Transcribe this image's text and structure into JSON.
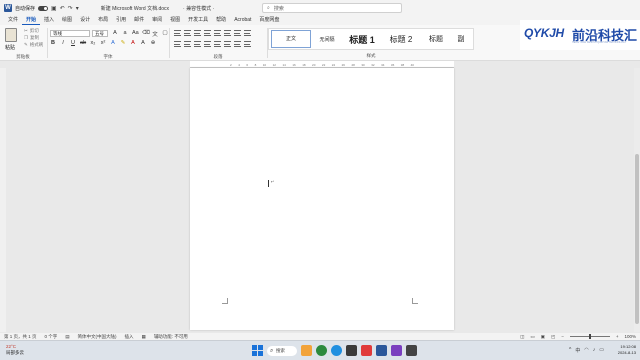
{
  "titlebar": {
    "autosave_label": "自动保存",
    "doc_name": "新建 Microsoft Word 文档.docx",
    "mode": "·  兼容性模式  ·"
  },
  "search": {
    "placeholder": "搜索"
  },
  "tabs": [
    "文件",
    "开始",
    "插入",
    "绘图",
    "设计",
    "布局",
    "引用",
    "邮件",
    "审阅",
    "视图",
    "开发工具",
    "帮助",
    "Acrobat",
    "百度网盘"
  ],
  "active_tab": "开始",
  "ribbon": {
    "paste_label": "粘贴",
    "cut_label": "剪切",
    "copy_label": "复制",
    "format_painter_label": "格式刷",
    "clipboard_group": "剪贴板",
    "font_name": "等线",
    "font_size": "五号",
    "font_group": "字体",
    "paragraph_group": "段落",
    "styles_group": "样式",
    "styles": [
      "正文",
      "无间隔",
      "标题 1",
      "标题 2",
      "标题",
      "副"
    ]
  },
  "brand": {
    "logo": "QYKJH",
    "name": "前沿科技汇",
    "tagline": "HENGYUAN KEJIHUI QIANYAN TECHNOLOGY"
  },
  "ruler": {
    "ticks": [
      "2",
      "4",
      "6",
      "8",
      "10",
      "12",
      "14",
      "16",
      "18",
      "20",
      "22",
      "24",
      "26",
      "28",
      "30",
      "32",
      "34",
      "36",
      "38",
      "40"
    ]
  },
  "statusbar": {
    "page": "第 1 页，共 1 页",
    "words": "0 个字",
    "language": "简体中文(中国大陆)",
    "insert": "插入",
    "accessibility": "辅助功能: 不可用",
    "zoom": "100%"
  },
  "taskbar": {
    "temp": "22°C",
    "weather": "局部多云",
    "search_label": "搜索",
    "time": "19:12:08",
    "date": "2024-8-13"
  }
}
